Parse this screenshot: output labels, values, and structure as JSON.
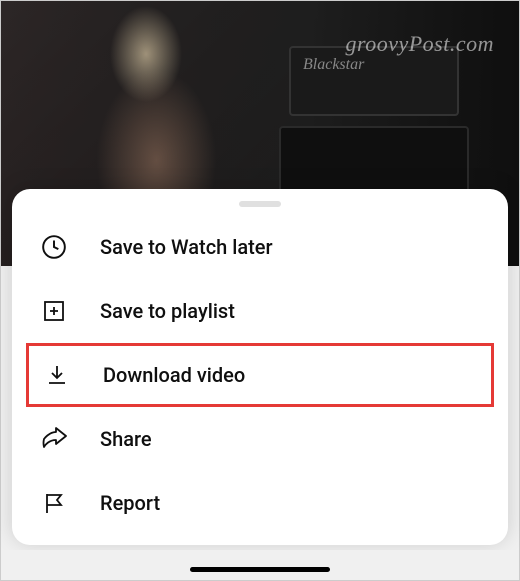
{
  "watermark": "groovyPost.com",
  "thumbnail": {
    "amplifier_brand": "Blackstar"
  },
  "menu": {
    "items": [
      {
        "label": "Save to Watch later",
        "icon": "clock-icon",
        "highlighted": false
      },
      {
        "label": "Save to playlist",
        "icon": "playlist-add-icon",
        "highlighted": false
      },
      {
        "label": "Download video",
        "icon": "download-icon",
        "highlighted": true
      },
      {
        "label": "Share",
        "icon": "share-icon",
        "highlighted": false
      },
      {
        "label": "Report",
        "icon": "flag-icon",
        "highlighted": false
      }
    ]
  }
}
